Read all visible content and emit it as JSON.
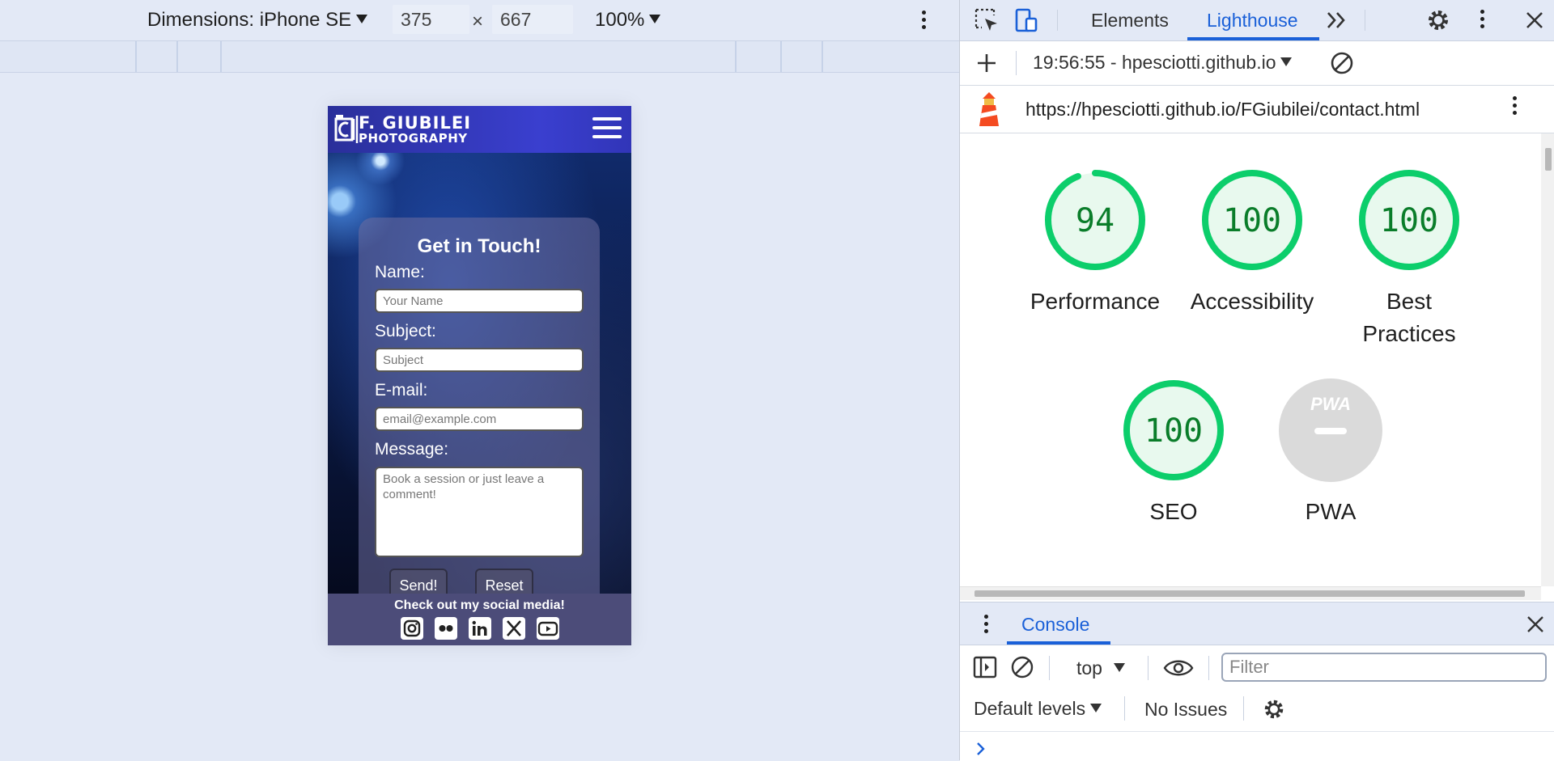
{
  "device_toolbar": {
    "dimensions_label": "Dimensions: iPhone SE",
    "width": "375",
    "times": "×",
    "height": "667",
    "zoom": "100%"
  },
  "phone": {
    "logo_line1": "F. GIUBILEI",
    "logo_line2": "PHOTOGRAPHY",
    "form": {
      "title": "Get in Touch!",
      "name_label": "Name:",
      "name_placeholder": "Your Name",
      "subject_label": "Subject:",
      "subject_placeholder": "Subject",
      "email_label": "E-mail:",
      "email_placeholder": "email@example.com",
      "message_label": "Message:",
      "message_placeholder": "Book a session or just leave a comment!",
      "send_label": "Send!",
      "reset_label": "Reset"
    },
    "footer": {
      "text": "Check out my social media!",
      "socials": [
        "instagram-icon",
        "flickr-icon",
        "linkedin-icon",
        "x-twitter-icon",
        "youtube-icon"
      ]
    }
  },
  "devtools": {
    "tabs": [
      "Elements",
      "Lighthouse"
    ],
    "active_tab": "Lighthouse",
    "report_select": "19:56:55 - hpesciotti.github.io",
    "url": "https://hpesciotti.github.io/FGiubilei/contact.html",
    "scores": [
      {
        "label": "Performance",
        "value": "94",
        "fraction": 0.94
      },
      {
        "label": "Accessibility",
        "value": "100",
        "fraction": 1.0
      },
      {
        "label": "Best Practices",
        "value": "100",
        "fraction": 1.0
      },
      {
        "label": "SEO",
        "value": "100",
        "fraction": 1.0
      },
      {
        "label": "PWA",
        "value": "PWA",
        "fraction": null
      }
    ],
    "colors": {
      "pass": "#0cce6b",
      "pass_fill": "#e8f9ee",
      "pass_text": "#0a7d2a",
      "accent": "#1a60d8",
      "na": "#dadada"
    },
    "console": {
      "tab": "Console",
      "context": "top",
      "filter_placeholder": "Filter",
      "levels": "Default levels",
      "issues": "No Issues"
    }
  }
}
